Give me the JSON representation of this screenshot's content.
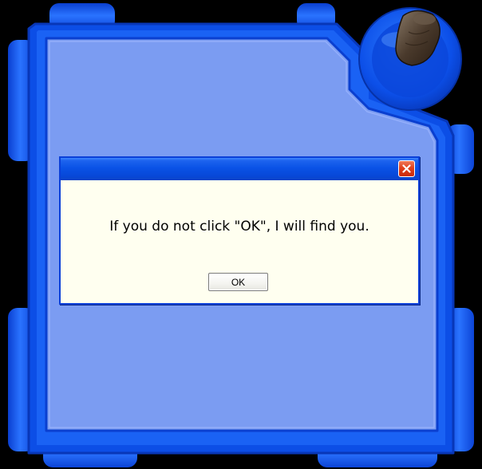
{
  "dialog": {
    "title": "",
    "message": "If you do not click \"OK\", I will find you.",
    "ok_label": "OK",
    "close_icon": "close-x-icon"
  },
  "colors": {
    "frame_blue": "#1a5cf0",
    "panel_blue": "#7b9cf2",
    "titlebar_blue": "#0a52e6",
    "dialog_background": "#fffff0",
    "close_red": "#e0401c",
    "scene_background": "#000000"
  }
}
